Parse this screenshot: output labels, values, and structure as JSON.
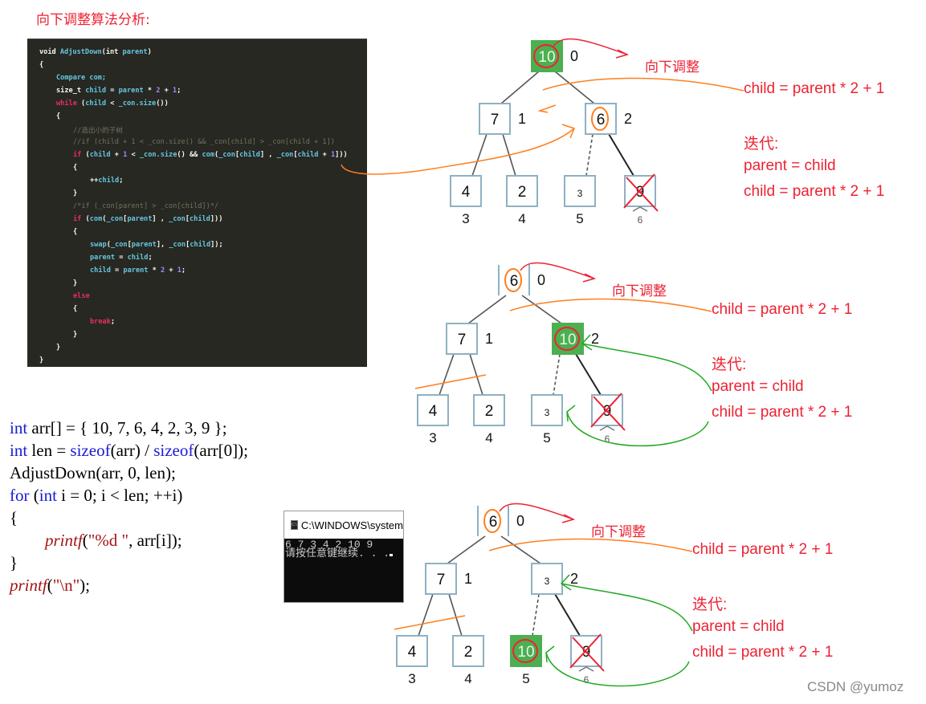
{
  "title": "向下调整算法分析:",
  "code_block": {
    "lines": [
      {
        "indent": 0,
        "parts": [
          [
            "kw2",
            "void "
          ],
          [
            "fn",
            "AdjustDown"
          ],
          [
            "wh",
            "("
          ],
          [
            "kw2",
            "int "
          ],
          [
            "fn",
            "parent"
          ],
          [
            "wh",
            ")"
          ]
        ]
      },
      {
        "indent": 0,
        "parts": [
          [
            "wh",
            "{"
          ]
        ]
      },
      {
        "indent": 1,
        "parts": [
          [
            "fn",
            "Compare com;"
          ]
        ]
      },
      {
        "indent": 1,
        "parts": [
          [
            "wh",
            "size_t "
          ],
          [
            "fn",
            "child"
          ],
          [
            "wh",
            " = "
          ],
          [
            "fn",
            "parent"
          ],
          [
            "wh",
            " * "
          ],
          [
            "num",
            "2"
          ],
          [
            "wh",
            " + "
          ],
          [
            "num",
            "1"
          ],
          [
            "wh",
            ";"
          ]
        ]
      },
      {
        "indent": 1,
        "parts": [
          [
            "kw",
            "while "
          ],
          [
            "wh",
            "("
          ],
          [
            "fn",
            "child"
          ],
          [
            "wh",
            " < "
          ],
          [
            "fn",
            "_con.size"
          ],
          [
            "wh",
            "())"
          ]
        ]
      },
      {
        "indent": 1,
        "parts": [
          [
            "wh",
            "{"
          ]
        ]
      },
      {
        "indent": 2,
        "parts": [
          [
            "cmt",
            "//选出小的子树"
          ]
        ]
      },
      {
        "indent": 2,
        "parts": [
          [
            "cmt",
            "//if (child + 1 < _con.size() && _con[child] > _con[child + 1])"
          ]
        ]
      },
      {
        "indent": 2,
        "parts": [
          [
            "kw",
            "if "
          ],
          [
            "wh",
            "("
          ],
          [
            "fn",
            "child"
          ],
          [
            "wh",
            " + "
          ],
          [
            "num",
            "1"
          ],
          [
            "wh",
            " < "
          ],
          [
            "fn",
            "_con.size"
          ],
          [
            "wh",
            "() && "
          ],
          [
            "fn",
            "com"
          ],
          [
            "wh",
            "("
          ],
          [
            "fn",
            "_con"
          ],
          [
            "wh",
            "["
          ],
          [
            "fn",
            "child"
          ],
          [
            "wh",
            "] , "
          ],
          [
            "fn",
            "_con"
          ],
          [
            "wh",
            "["
          ],
          [
            "fn",
            "child"
          ],
          [
            "wh",
            " + "
          ],
          [
            "num",
            "1"
          ],
          [
            "wh",
            "]))"
          ]
        ]
      },
      {
        "indent": 2,
        "parts": [
          [
            "wh",
            "{"
          ]
        ]
      },
      {
        "indent": 3,
        "parts": [
          [
            "wh",
            "++"
          ],
          [
            "fn",
            "child"
          ],
          [
            "wh",
            ";"
          ]
        ]
      },
      {
        "indent": 2,
        "parts": [
          [
            "wh",
            "}"
          ]
        ]
      },
      {
        "indent": 2,
        "parts": [
          [
            "cmt",
            "/*if (_con[parent] > _con[child])*/"
          ]
        ]
      },
      {
        "indent": 2,
        "parts": [
          [
            "kw",
            "if "
          ],
          [
            "wh",
            "("
          ],
          [
            "fn",
            "com"
          ],
          [
            "wh",
            "("
          ],
          [
            "fn",
            "_con"
          ],
          [
            "wh",
            "["
          ],
          [
            "fn",
            "parent"
          ],
          [
            "wh",
            "] , "
          ],
          [
            "fn",
            "_con"
          ],
          [
            "wh",
            "["
          ],
          [
            "fn",
            "child"
          ],
          [
            "wh",
            "]))"
          ]
        ]
      },
      {
        "indent": 2,
        "parts": [
          [
            "wh",
            "{"
          ]
        ]
      },
      {
        "indent": 3,
        "parts": [
          [
            "fn",
            "swap"
          ],
          [
            "wh",
            "("
          ],
          [
            "fn",
            "_con"
          ],
          [
            "wh",
            "["
          ],
          [
            "fn",
            "parent"
          ],
          [
            "wh",
            "], "
          ],
          [
            "fn",
            "_con"
          ],
          [
            "wh",
            "["
          ],
          [
            "fn",
            "child"
          ],
          [
            "wh",
            "]);"
          ]
        ]
      },
      {
        "indent": 3,
        "parts": [
          [
            "fn",
            "parent"
          ],
          [
            "wh",
            " = "
          ],
          [
            "fn",
            "child"
          ],
          [
            "wh",
            ";"
          ]
        ]
      },
      {
        "indent": 3,
        "parts": [
          [
            "fn",
            "child"
          ],
          [
            "wh",
            " = "
          ],
          [
            "fn",
            "parent"
          ],
          [
            "wh",
            " * "
          ],
          [
            "num",
            "2"
          ],
          [
            "wh",
            " + "
          ],
          [
            "num",
            "1"
          ],
          [
            "wh",
            ";"
          ]
        ]
      },
      {
        "indent": 2,
        "parts": [
          [
            "wh",
            "}"
          ]
        ]
      },
      {
        "indent": 2,
        "parts": [
          [
            "kw",
            "else"
          ]
        ]
      },
      {
        "indent": 2,
        "parts": [
          [
            "wh",
            "{"
          ]
        ]
      },
      {
        "indent": 3,
        "parts": [
          [
            "kw",
            "break"
          ],
          [
            "wh",
            ";"
          ]
        ]
      },
      {
        "indent": 2,
        "parts": [
          [
            "wh",
            "}"
          ]
        ]
      },
      {
        "indent": 1,
        "parts": [
          [
            "wh",
            "}"
          ]
        ]
      },
      {
        "indent": 0,
        "parts": [
          [
            "wh",
            "}"
          ]
        ]
      }
    ]
  },
  "test_code": {
    "line1_kw": "int",
    "line1_rest": " arr[] = { 10, 7, 6, 4, 2, 3, 9 };",
    "line2_kw": "int",
    "line2_mid": " len = ",
    "line2_fn1": "sizeof",
    "line2_a": "(arr) / ",
    "line2_fn2": "sizeof",
    "line2_b": "(arr[0]);",
    "line3": "AdjustDown(arr, 0, len);",
    "line4_kw": "for",
    "line4_a": " (",
    "line4_kw2": "int",
    "line4_b": " i = 0; i < len; ++i)",
    "line5": "{",
    "line6_fn": "printf",
    "line6_a": "(",
    "line6_str": "\"%d \"",
    "line6_b": ", arr[i]);",
    "line7": "}",
    "line8_fn": "printf",
    "line8_a": "(",
    "line8_str": "\"\\n\"",
    "line8_b": ");"
  },
  "console": {
    "title": "C:\\WINDOWS\\system",
    "output_line1": "6 7 3 4 2 10 9",
    "output_line2": "请按任意键继续. . ."
  },
  "diagrams": [
    {
      "nodes": [
        {
          "value": "10",
          "index": "0",
          "state": "highlighted",
          "circled": "red"
        },
        {
          "value": "7",
          "index": "1"
        },
        {
          "value": "6",
          "index": "2",
          "circled": "orange"
        },
        {
          "value": "4",
          "index": "3"
        },
        {
          "value": "2",
          "index": "4"
        },
        {
          "value": "3",
          "index": "5",
          "small": true
        },
        {
          "value": "9",
          "index": "6",
          "crossed": true
        }
      ],
      "label_adjust": "向下调整",
      "formula": "child = parent * 2 + 1",
      "iter_title": "迭代:",
      "iter_line1": "parent = child",
      "iter_line2": "child = parent * 2 + 1"
    },
    {
      "nodes": [
        {
          "value": "6",
          "index": "0",
          "circled": "orange",
          "open": true
        },
        {
          "value": "7",
          "index": "1"
        },
        {
          "value": "10",
          "index": "2",
          "state": "highlighted",
          "circled": "red"
        },
        {
          "value": "4",
          "index": "3"
        },
        {
          "value": "2",
          "index": "4"
        },
        {
          "value": "3",
          "index": "5",
          "small": true
        },
        {
          "value": "9",
          "index": "6",
          "crossed": true
        }
      ],
      "label_adjust": "向下调整",
      "formula": "child = parent * 2 + 1",
      "iter_title": "迭代:",
      "iter_line1": "parent = child",
      "iter_line2": "child = parent * 2 + 1"
    },
    {
      "nodes": [
        {
          "value": "6",
          "index": "0",
          "circled": "orange",
          "open": true
        },
        {
          "value": "7",
          "index": "1"
        },
        {
          "value": "3",
          "index": "2",
          "small": true
        },
        {
          "value": "4",
          "index": "3"
        },
        {
          "value": "2",
          "index": "4"
        },
        {
          "value": "10",
          "index": "5",
          "state": "highlighted",
          "circled": "red"
        },
        {
          "value": "9",
          "index": "6",
          "crossed": true
        }
      ],
      "label_adjust": "向下调整",
      "formula": "child = parent * 2 + 1",
      "iter_title": "迭代:",
      "iter_line1": "parent = child",
      "iter_line2": "child = parent * 2 + 1"
    }
  ],
  "colors": {
    "highlight_green": "#4caf50",
    "node_border": "#8fb0c2",
    "annotation_red": "#ee2233",
    "annotation_orange": "#ff7f1e",
    "annotation_green": "#22aa22"
  },
  "watermark": "CSDN @yumoz"
}
